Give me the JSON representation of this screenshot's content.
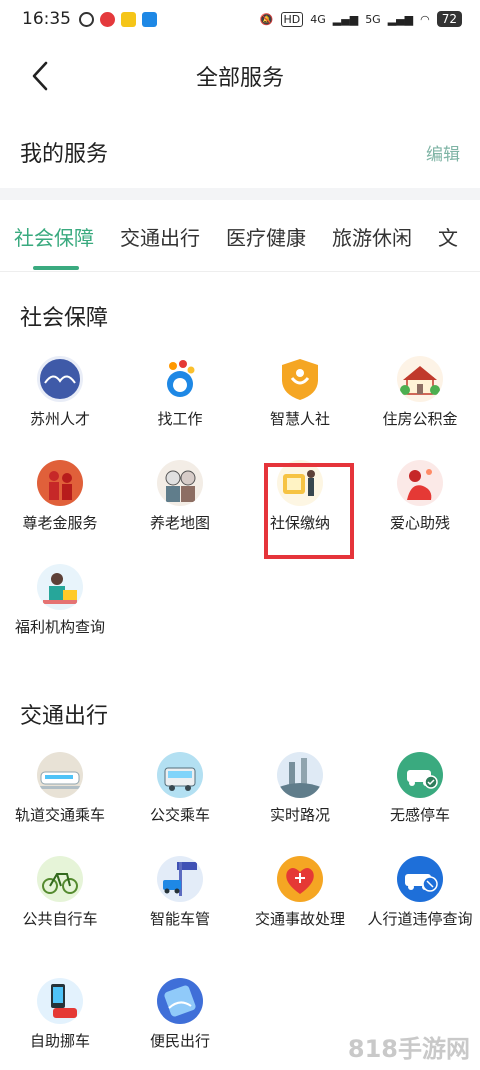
{
  "status_bar": {
    "time": "16:35",
    "network_1": "HD",
    "network_2": "4G",
    "network_3": "5G",
    "battery": "72"
  },
  "header": {
    "title": "全部服务"
  },
  "my_services": {
    "title": "我的服务",
    "edit_label": "编辑"
  },
  "tabs": [
    {
      "label": "社会保障"
    },
    {
      "label": "交通出行"
    },
    {
      "label": "医疗健康"
    },
    {
      "label": "旅游休闲"
    },
    {
      "label": "文"
    }
  ],
  "sections": [
    {
      "title": "社会保障",
      "items": [
        {
          "label": "苏州人才",
          "icon": "suzhou-talent-icon"
        },
        {
          "label": "找工作",
          "icon": "find-job-icon"
        },
        {
          "label": "智慧人社",
          "icon": "smart-hr-icon"
        },
        {
          "label": "住房公积金",
          "icon": "housing-fund-icon"
        },
        {
          "label": "尊老金服务",
          "icon": "elderly-allowance-icon"
        },
        {
          "label": "养老地图",
          "icon": "elderly-map-icon"
        },
        {
          "label": "社保缴纳",
          "icon": "social-security-payment-icon"
        },
        {
          "label": "爱心助残",
          "icon": "disability-help-icon"
        },
        {
          "label": "福利机构查询",
          "icon": "welfare-institution-icon"
        }
      ]
    },
    {
      "title": "交通出行",
      "items": [
        {
          "label": "轨道交通乘车",
          "icon": "metro-icon"
        },
        {
          "label": "公交乘车",
          "icon": "bus-icon"
        },
        {
          "label": "实时路况",
          "icon": "traffic-icon"
        },
        {
          "label": "无感停车",
          "icon": "parking-icon"
        },
        {
          "label": "公共自行车",
          "icon": "bike-icon"
        },
        {
          "label": "智能车管",
          "icon": "vehicle-admin-icon"
        },
        {
          "label": "交通事故处理",
          "icon": "accident-icon"
        },
        {
          "label": "人行道违停查询",
          "icon": "sidewalk-parking-icon"
        },
        {
          "label": "自助挪车",
          "icon": "move-car-icon"
        },
        {
          "label": "便民出行",
          "icon": "convenient-travel-icon"
        }
      ]
    }
  ],
  "watermark": "818手游网",
  "colors": {
    "accent": "#3aaa7f",
    "highlight": "#e5343a"
  }
}
